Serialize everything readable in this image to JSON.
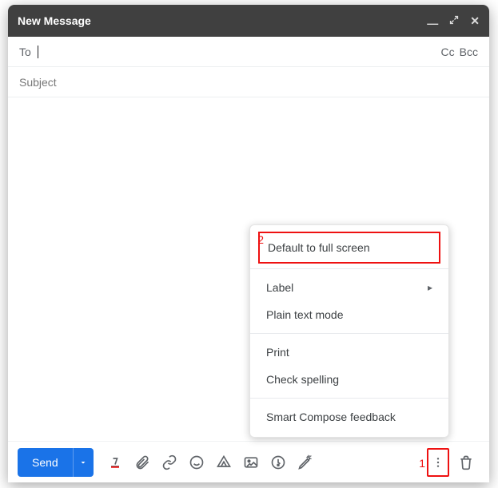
{
  "header": {
    "title": "New Message"
  },
  "fields": {
    "to_label": "To",
    "to_value": "",
    "cc_label": "Cc",
    "bcc_label": "Bcc",
    "subject_placeholder": "Subject",
    "subject_value": ""
  },
  "toolbar": {
    "send_label": "Send"
  },
  "menu": {
    "default_full_screen": "Default to full screen",
    "label": "Label",
    "plain_text": "Plain text mode",
    "print": "Print",
    "check_spelling": "Check spelling",
    "smart_compose": "Smart Compose feedback"
  },
  "annotations": {
    "one": "1",
    "two": "2"
  }
}
